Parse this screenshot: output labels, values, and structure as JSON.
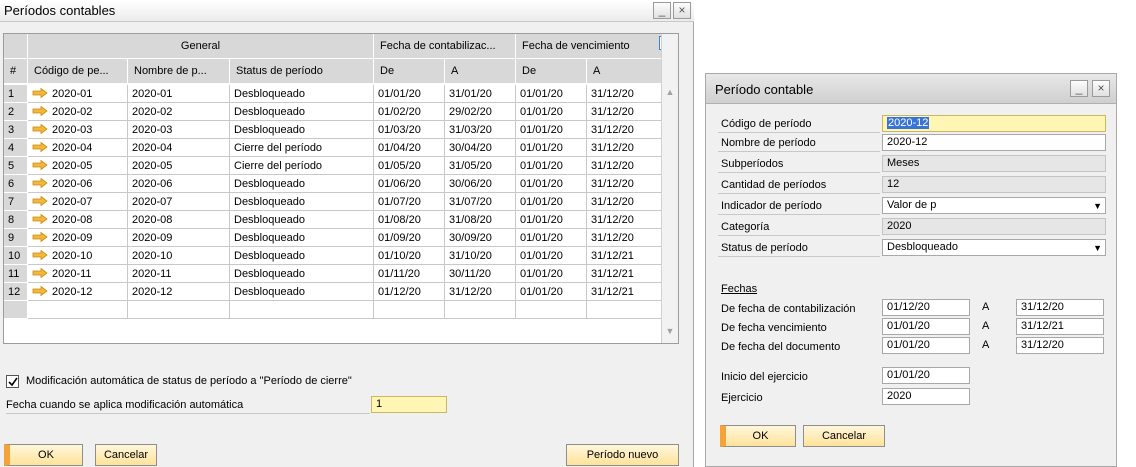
{
  "left_window": {
    "title": "Períodos contables",
    "minimize": "_",
    "close": "×",
    "headers": {
      "group_general": "General",
      "group_posting": "Fecha de contabilizac...",
      "group_due": "Fecha de vencimiento",
      "col_num": "#",
      "col_code": "Código de pe...",
      "col_name": "Nombre de p...",
      "col_status": "Status de período",
      "col_from1": "De",
      "col_to1": "A",
      "col_from2": "De",
      "col_to2": "A"
    },
    "rows": [
      {
        "n": "1",
        "code": "2020-01",
        "name": "2020-01",
        "status": "Desbloqueado",
        "from1": "01/01/20",
        "to1": "31/01/20",
        "from2": "01/01/20",
        "to2": "31/12/20"
      },
      {
        "n": "2",
        "code": "2020-02",
        "name": "2020-02",
        "status": "Desbloqueado",
        "from1": "01/02/20",
        "to1": "29/02/20",
        "from2": "01/01/20",
        "to2": "31/12/20"
      },
      {
        "n": "3",
        "code": "2020-03",
        "name": "2020-03",
        "status": "Desbloqueado",
        "from1": "01/03/20",
        "to1": "31/03/20",
        "from2": "01/01/20",
        "to2": "31/12/20"
      },
      {
        "n": "4",
        "code": "2020-04",
        "name": "2020-04",
        "status": "Cierre del período",
        "from1": "01/04/20",
        "to1": "30/04/20",
        "from2": "01/01/20",
        "to2": "31/12/20"
      },
      {
        "n": "5",
        "code": "2020-05",
        "name": "2020-05",
        "status": "Cierre del período",
        "from1": "01/05/20",
        "to1": "31/05/20",
        "from2": "01/01/20",
        "to2": "31/12/20"
      },
      {
        "n": "6",
        "code": "2020-06",
        "name": "2020-06",
        "status": "Desbloqueado",
        "from1": "01/06/20",
        "to1": "30/06/20",
        "from2": "01/01/20",
        "to2": "31/12/20"
      },
      {
        "n": "7",
        "code": "2020-07",
        "name": "2020-07",
        "status": "Desbloqueado",
        "from1": "01/07/20",
        "to1": "31/07/20",
        "from2": "01/01/20",
        "to2": "31/12/20"
      },
      {
        "n": "8",
        "code": "2020-08",
        "name": "2020-08",
        "status": "Desbloqueado",
        "from1": "01/08/20",
        "to1": "31/08/20",
        "from2": "01/01/20",
        "to2": "31/12/20"
      },
      {
        "n": "9",
        "code": "2020-09",
        "name": "2020-09",
        "status": "Desbloqueado",
        "from1": "01/09/20",
        "to1": "30/09/20",
        "from2": "01/01/20",
        "to2": "31/12/20"
      },
      {
        "n": "10",
        "code": "2020-10",
        "name": "2020-10",
        "status": "Desbloqueado",
        "from1": "01/10/20",
        "to1": "31/10/20",
        "from2": "01/01/20",
        "to2": "31/12/21"
      },
      {
        "n": "11",
        "code": "2020-11",
        "name": "2020-11",
        "status": "Desbloqueado",
        "from1": "01/11/20",
        "to1": "30/11/20",
        "from2": "01/01/20",
        "to2": "31/12/21"
      },
      {
        "n": "12",
        "code": "2020-12",
        "name": "2020-12",
        "status": "Desbloqueado",
        "from1": "01/12/20",
        "to1": "31/12/20",
        "from2": "01/01/20",
        "to2": "31/12/21"
      }
    ],
    "auto_change_checkbox": "Modificación automática de status de período a \"Período de cierre\"",
    "auto_change_date_label": "Fecha cuando se aplica modificación automática",
    "auto_change_date_value": "1",
    "ok": "OK",
    "cancel": "Cancelar",
    "new_period": "Período nuevo"
  },
  "right_window": {
    "title": "Período contable",
    "minimize": "_",
    "close": "×",
    "fields": {
      "code_label": "Código de período",
      "code_value": "2020-12",
      "name_label": "Nombre de período",
      "name_value": "2020-12",
      "sub_label": "Subperíodos",
      "sub_value": "Meses",
      "qty_label": "Cantidad de períodos",
      "qty_value": "12",
      "indicator_label": "Indicador de período",
      "indicator_value": "Valor de p",
      "category_label": "Categoría",
      "category_value": "2020",
      "status_label": "Status de período",
      "status_value": "Desbloqueado"
    },
    "dates_heading": "Fechas",
    "posting_label": "De fecha de contabilización",
    "posting_from": "01/12/20",
    "posting_to": "31/12/20",
    "due_label": "De fecha vencimiento",
    "due_from": "01/01/20",
    "due_to": "31/12/21",
    "doc_label": "De fecha del documento",
    "doc_from": "01/01/20",
    "doc_to": "31/12/20",
    "a_label": "A",
    "fy_start_label": "Inicio del ejercicio",
    "fy_start_value": "01/01/20",
    "fy_label": "Ejercicio",
    "fy_value": "2020",
    "ok": "OK",
    "cancel": "Cancelar"
  },
  "colors": {
    "accent_arrow": "#f3b73c",
    "highlight_field": "#fff5b4",
    "selection": "#3874d8"
  }
}
